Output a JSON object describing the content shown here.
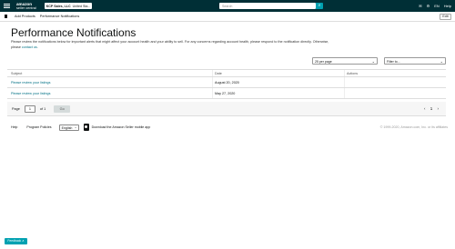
{
  "topbar": {
    "logo_main": "amazon",
    "logo_sub": "seller central",
    "account_name": "KCP Sales, LLC",
    "account_region": "United Sta...",
    "search_placeholder": "Search",
    "search_icon": "search-icon",
    "icons": [
      "mail-icon",
      "gear-icon"
    ],
    "language": "EN",
    "help": "Help"
  },
  "navbar": {
    "links": [
      "Add Products",
      "Performance Notifications"
    ],
    "edit_label": "Edit"
  },
  "page": {
    "title": "Performance Notifications",
    "description_line1": "Please review the notifications below for important alerts that might affect your account health and your ability to sell. For any concerns regarding account health, please respond to the notification",
    "description_line2": "directly. Otherwise, please",
    "contact_link": "contact us",
    "per_page": "25 per page",
    "filter_placeholder": "Filter to..."
  },
  "table": {
    "headers": [
      "Subject",
      "Date",
      "Actions"
    ],
    "rows": [
      {
        "subject": "Please review your listings",
        "date": "August 20, 2020"
      },
      {
        "subject": "Please review your listings",
        "date": "May 27, 2020"
      }
    ]
  },
  "pager": {
    "page_label": "Page",
    "page_value": "1",
    "of_label": "of 1",
    "go_label": "Go",
    "arrows": "‹ 1 ›"
  },
  "footer": {
    "help": "Help",
    "policies": "Program Policies",
    "language": "English",
    "download": "Download the Amazon Seller mobile app",
    "copyright": "© 1999-2020, Amazon.com, Inc. or its affiliates"
  },
  "bottom": {
    "button_label": "Feedback ∧"
  }
}
